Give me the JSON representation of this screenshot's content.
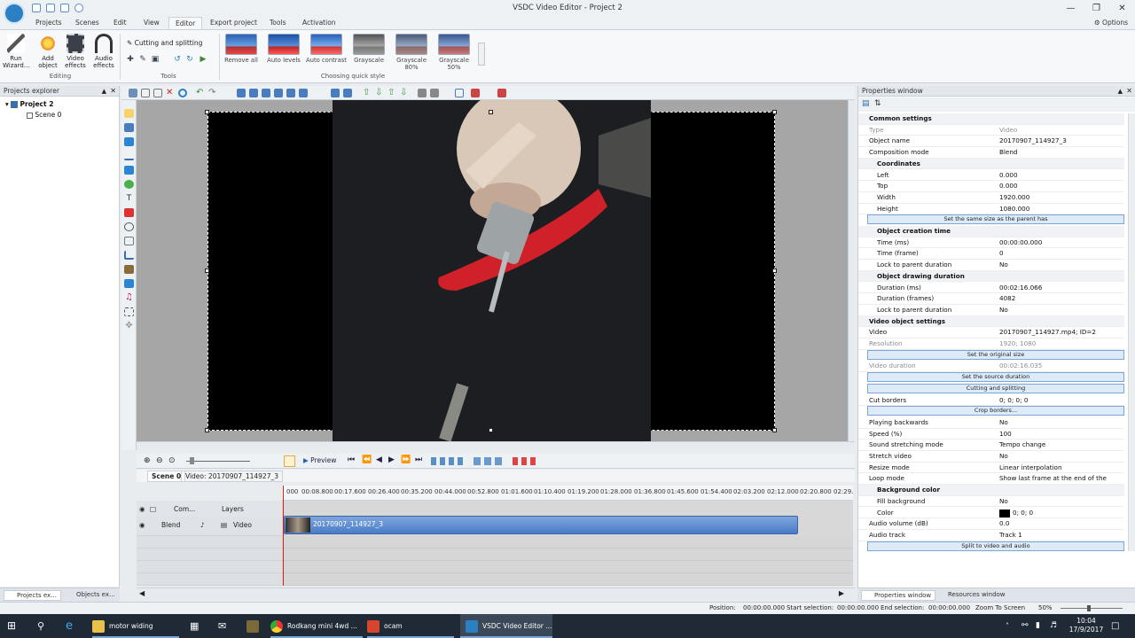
{
  "window": {
    "title": "VSDC Video Editor - Project 2"
  },
  "menu": {
    "tabs": [
      "Projects",
      "Scenes",
      "Edit",
      "View",
      "Editor",
      "Export project",
      "Tools",
      "Activation"
    ],
    "active": "Editor",
    "options": "Options"
  },
  "ribbon": {
    "run_wizard": "Run\nWizard...",
    "add_object": "Add\nobject",
    "video_effects": "Video\neffects",
    "audio_effects": "Audio\neffects",
    "group_editing": "Editing",
    "cutting_splitting": "Cutting and splitting",
    "group_tools": "Tools",
    "quick_styles": [
      "Remove all",
      "Auto levels",
      "Auto contrast",
      "Grayscale",
      "Grayscale 80%",
      "Grayscale 50%"
    ],
    "group_quick_style": "Choosing quick style"
  },
  "projects": {
    "header": "Projects explorer",
    "project": "Project 2",
    "scene": "Scene 0",
    "tabs": [
      "Projects ex...",
      "Objects ex..."
    ]
  },
  "timeline": {
    "preview": "Preview",
    "scene_tab": "Scene 0",
    "video_tab": "Video: 20170907_114927_3",
    "ticks": [
      "000",
      "00:08.800",
      "00:17.600",
      "00:26.400",
      "00:35.200",
      "00:44.000",
      "00:52.800",
      "01:01.600",
      "01:10.400",
      "01:19.200",
      "01:28.000",
      "01:36.800",
      "01:45.600",
      "01:54.400",
      "02:03.200",
      "02:12.000",
      "02:20.800",
      "02:29."
    ],
    "header_com": "Com...",
    "header_layers": "Layers",
    "track_blend": "Blend",
    "track_name": "Video",
    "clip_name": "20170907_114927_3"
  },
  "properties": {
    "header": "Properties window",
    "common": "Common settings",
    "type_k": "Type",
    "type_v": "Video",
    "objname_k": "Object name",
    "objname_v": "20170907_114927_3",
    "comp_k": "Composition mode",
    "comp_v": "Blend",
    "coords": "Coordinates",
    "left_k": "Left",
    "left_v": "0.000",
    "top_k": "Top",
    "top_v": "0.000",
    "width_k": "Width",
    "width_v": "1920.000",
    "height_k": "Height",
    "height_v": "1080.000",
    "btn_same_size": "Set the same size as the parent has",
    "creation": "Object creation time",
    "tms_k": "Time (ms)",
    "tms_v": "00:00:00.000",
    "tfr_k": "Time (frame)",
    "tfr_v": "0",
    "lock1_k": "Lock to parent duration",
    "lock1_v": "No",
    "drawing": "Object drawing duration",
    "dms_k": "Duration (ms)",
    "dms_v": "00:02:16.066",
    "dfr_k": "Duration (frames)",
    "dfr_v": "4082",
    "lock2_k": "Lock to parent duration",
    "lock2_v": "No",
    "vsettings": "Video object settings",
    "video_k": "Video",
    "video_v": "20170907_114927.mp4; ID=2",
    "res_k": "Resolution",
    "res_v": "1920; 1080",
    "btn_original": "Set the original size",
    "vdur_k": "Video duration",
    "vdur_v": "00:02:16.035",
    "btn_source": "Set the source duration",
    "btn_cutting": "Cutting and splitting",
    "cut_k": "Cut borders",
    "cut_v": "0; 0; 0; 0",
    "btn_crop": "Crop borders...",
    "back_k": "Playing backwards",
    "back_v": "No",
    "speed_k": "Speed (%)",
    "speed_v": "100",
    "stretchmode_k": "Sound stretching mode",
    "stretchmode_v": "Tempo change",
    "stretch_k": "Stretch video",
    "stretch_v": "No",
    "resize_k": "Resize mode",
    "resize_v": "Linear interpolation",
    "loop_k": "Loop mode",
    "loop_v": "Show last frame at the end of the video",
    "bg": "Background color",
    "fill_k": "Fill background",
    "fill_v": "No",
    "color_k": "Color",
    "color_v": "0; 0; 0",
    "avol_k": "Audio volume (dB)",
    "avol_v": "0.0",
    "atrack_k": "Audio track",
    "atrack_v": "Track 1",
    "btn_split": "Split to video and audio",
    "tabs": [
      "Properties window",
      "Resources window"
    ]
  },
  "status": {
    "position_label": "Position:",
    "position": "00:00:00.000",
    "start_label": "Start selection:",
    "start": "00:00:00.000",
    "end_label": "End selection:",
    "end": "00:00:00.000",
    "zoom": "Zoom To Screen",
    "zoom_pct": "50%"
  },
  "taskbar": {
    "items": [
      "motor widing",
      "Rodkang mini 4wd ...",
      "ocam",
      "VSDC Video Editor ..."
    ],
    "time": "10:04",
    "date": "17/9/2017"
  },
  "colors": {
    "accent": "#2b7fc2",
    "clip": "#5b87cf",
    "playhead": "#dd2211"
  }
}
